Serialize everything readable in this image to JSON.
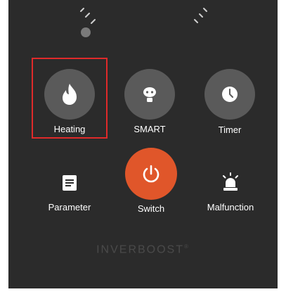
{
  "controls": {
    "heating": {
      "label": "Heating",
      "icon": "flame-icon",
      "selected": true
    },
    "smart": {
      "label": "SMART",
      "icon": "robot-icon"
    },
    "timer": {
      "label": "Timer",
      "icon": "clock-icon"
    },
    "parameter": {
      "label": "Parameter",
      "icon": "document-icon"
    },
    "switch": {
      "label": "Switch",
      "icon": "power-icon"
    },
    "malfunction": {
      "label": "Malfunction",
      "icon": "alarm-icon"
    }
  },
  "brand": {
    "text": "INVERBOOST",
    "mark": "®"
  },
  "colors": {
    "panel": "#2b2b2b",
    "button": "#5a5a5a",
    "switch_accent": "#e0562a",
    "selection_outline": "#e02a2a",
    "brand_text": "#4a4a4a"
  }
}
